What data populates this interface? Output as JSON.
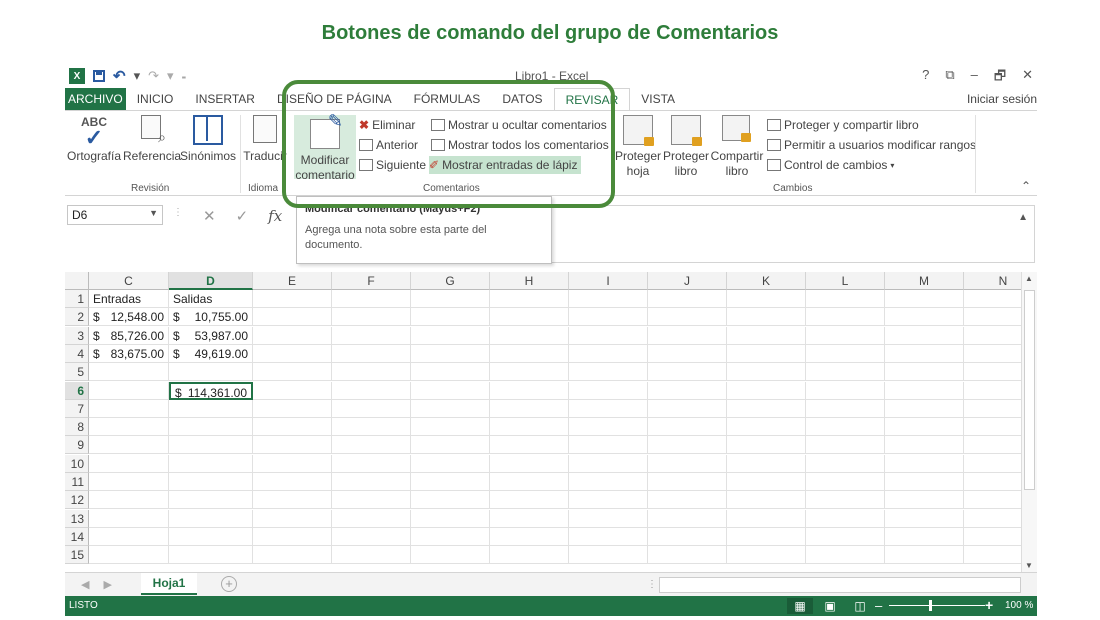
{
  "heading": "Botones de comando del grupo de Comentarios",
  "titlebar": {
    "app_title": "Libro1 - Excel",
    "logo": "X",
    "controls": [
      "?",
      "⧉",
      "–",
      "🗗",
      "✕"
    ]
  },
  "tabs": [
    "ARCHIVO",
    "INICIO",
    "INSERTAR",
    "DISEÑO DE PÁGINA",
    "FÓRMULAS",
    "DATOS",
    "REVISAR",
    "VISTA"
  ],
  "active_tab": "REVISAR",
  "signin": "Iniciar sesión",
  "ribbon": {
    "revision": {
      "label": "Revisión",
      "ortografia": "Ortografía",
      "referencia": "Referencia",
      "sinonimos": "Sinónimos",
      "abc": "ABC"
    },
    "idioma": {
      "label": "Idioma",
      "traducir": "Traducir"
    },
    "comentarios": {
      "label": "Comentarios",
      "modificar_line1": "Modificar",
      "modificar_line2": "comentario",
      "eliminar": "Eliminar",
      "anterior": "Anterior",
      "siguiente": "Siguiente",
      "mostrar_ocultar": "Mostrar u ocultar comentarios",
      "mostrar_todos": "Mostrar todos los comentarios",
      "mostrar_lapiz": "Mostrar entradas de lápiz"
    },
    "cambios": {
      "label": "Cambios",
      "proteger_hoja_1": "Proteger",
      "proteger_hoja_2": "hoja",
      "proteger_libro_1": "Proteger",
      "proteger_libro_2": "libro",
      "compartir_1": "Compartir",
      "compartir_2": "libro",
      "proteger_compartir": "Proteger y compartir libro",
      "permitir": "Permitir a usuarios modificar rangos",
      "control": "Control de cambios"
    }
  },
  "formula_bar": {
    "name_box": "D6",
    "fx": "fx"
  },
  "tooltip": {
    "title": "Modificar comentario (Mayús+F2)",
    "description": "Agrega una nota sobre esta parte del documento."
  },
  "grid": {
    "columns": [
      "C",
      "D",
      "E",
      "F",
      "G",
      "H",
      "I",
      "J",
      "K",
      "L",
      "M",
      "N"
    ],
    "selected_column": "D",
    "rows": [
      "1",
      "2",
      "3",
      "4",
      "5",
      "6",
      "7",
      "8",
      "9",
      "10",
      "11",
      "12",
      "13",
      "14",
      "15"
    ],
    "selected_row": "6",
    "cells": {
      "C1": "Entradas",
      "D1": "Salidas",
      "C2": "12,548.00",
      "D2": "10,755.00",
      "C3": "85,726.00",
      "D3": "53,987.00",
      "C4": "83,675.00",
      "D4": "49,619.00",
      "D6": "114,361.00"
    },
    "currency": "$"
  },
  "sheet": {
    "name": "Hoja1",
    "add": "+"
  },
  "status": {
    "text": "LISTO",
    "zoom": "100 %",
    "zoom_level": 0.42
  },
  "colors": {
    "accent": "#217346",
    "highlight_frame": "#4a8a3a",
    "heading": "#2e7d3a"
  }
}
